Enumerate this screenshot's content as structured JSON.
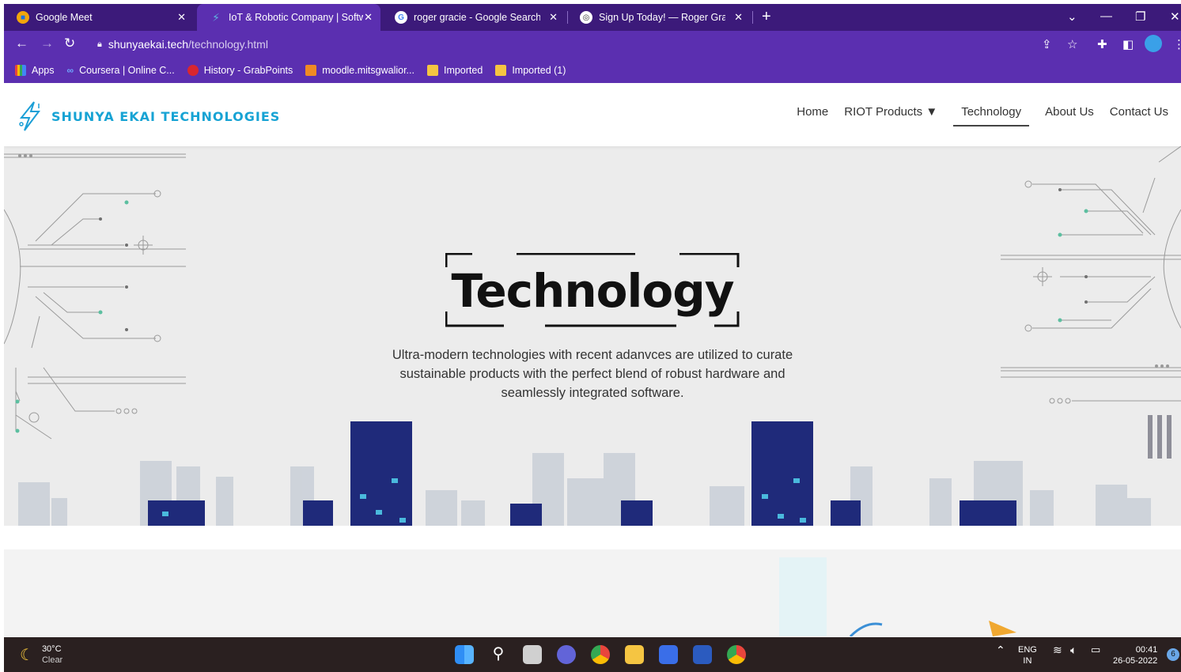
{
  "browser": {
    "tabs": [
      {
        "title": "Google Meet",
        "active": false
      },
      {
        "title": "IoT & Robotic Company | Software",
        "active": true
      },
      {
        "title": "roger gracie - Google Search",
        "active": false
      },
      {
        "title": "Sign Up Today! — Roger Gracie I",
        "active": false
      }
    ],
    "url_host": "shunyaekai.tech",
    "url_path": "/technology.html",
    "bookmarks": [
      {
        "label": "Apps",
        "color": "#e8453c"
      },
      {
        "label": "Coursera | Online C...",
        "color": "#2a73cc"
      },
      {
        "label": "History - GrabPoints",
        "color": "#d9262f"
      },
      {
        "label": "moodle.mitsgwalior...",
        "color": "#f08a24"
      },
      {
        "label": "Imported",
        "color": "#f5c542"
      },
      {
        "label": "Imported (1)",
        "color": "#f5c542"
      }
    ]
  },
  "site": {
    "logo_text": "SHUNYA EKAI TECHNOLOGIES",
    "nav": [
      {
        "label": "Home"
      },
      {
        "label": "RIOT Products ▼"
      },
      {
        "label": "Technology",
        "active": true
      },
      {
        "label": "About Us"
      },
      {
        "label": "Contact Us"
      }
    ],
    "hero_title": "Technology",
    "hero_subtitle": "Ultra-modern technologies with recent adanvces are utilized to curate sustainable products with the perfect blend of robust hardware and seamlessly integrated software."
  },
  "taskbar": {
    "temp": "30°C",
    "condition": "Clear",
    "lang_top": "ENG",
    "lang_bottom": "IN",
    "time": "00:41",
    "date": "26-05-2022",
    "notif_count": "6"
  },
  "colors": {
    "tab_strip": "#3c1a7a",
    "toolbar": "#5b2fb0",
    "brand": "#17a3d4",
    "taskbar": "#2a2020"
  }
}
